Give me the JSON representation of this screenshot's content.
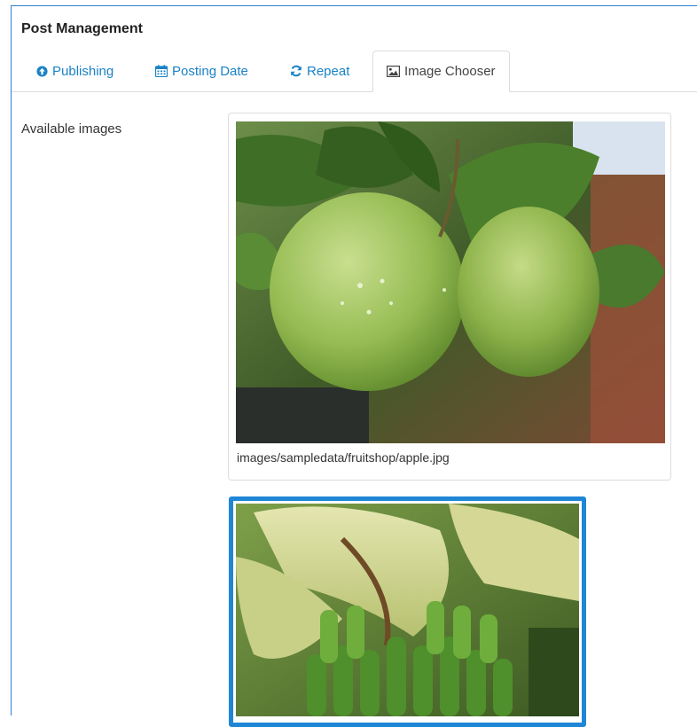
{
  "panel": {
    "title": "Post Management"
  },
  "tabs": [
    {
      "label": "Publishing",
      "icon": "circle-arrow-up-icon"
    },
    {
      "label": "Posting Date",
      "icon": "calendar-icon"
    },
    {
      "label": "Repeat",
      "icon": "refresh-icon"
    },
    {
      "label": "Image Chooser",
      "icon": "picture-icon",
      "active": true
    }
  ],
  "image_chooser": {
    "field_label": "Available images",
    "images": [
      {
        "caption": "images/sampledata/fruitshop/apple.jpg",
        "subject": "green-apples-photo"
      },
      {
        "caption": "",
        "subject": "green-bananas-photo",
        "selected": true
      }
    ]
  },
  "colors": {
    "accent": "#1a82c6",
    "selection_border": "#1f86d6",
    "panel_border": "#2c7fd1"
  }
}
